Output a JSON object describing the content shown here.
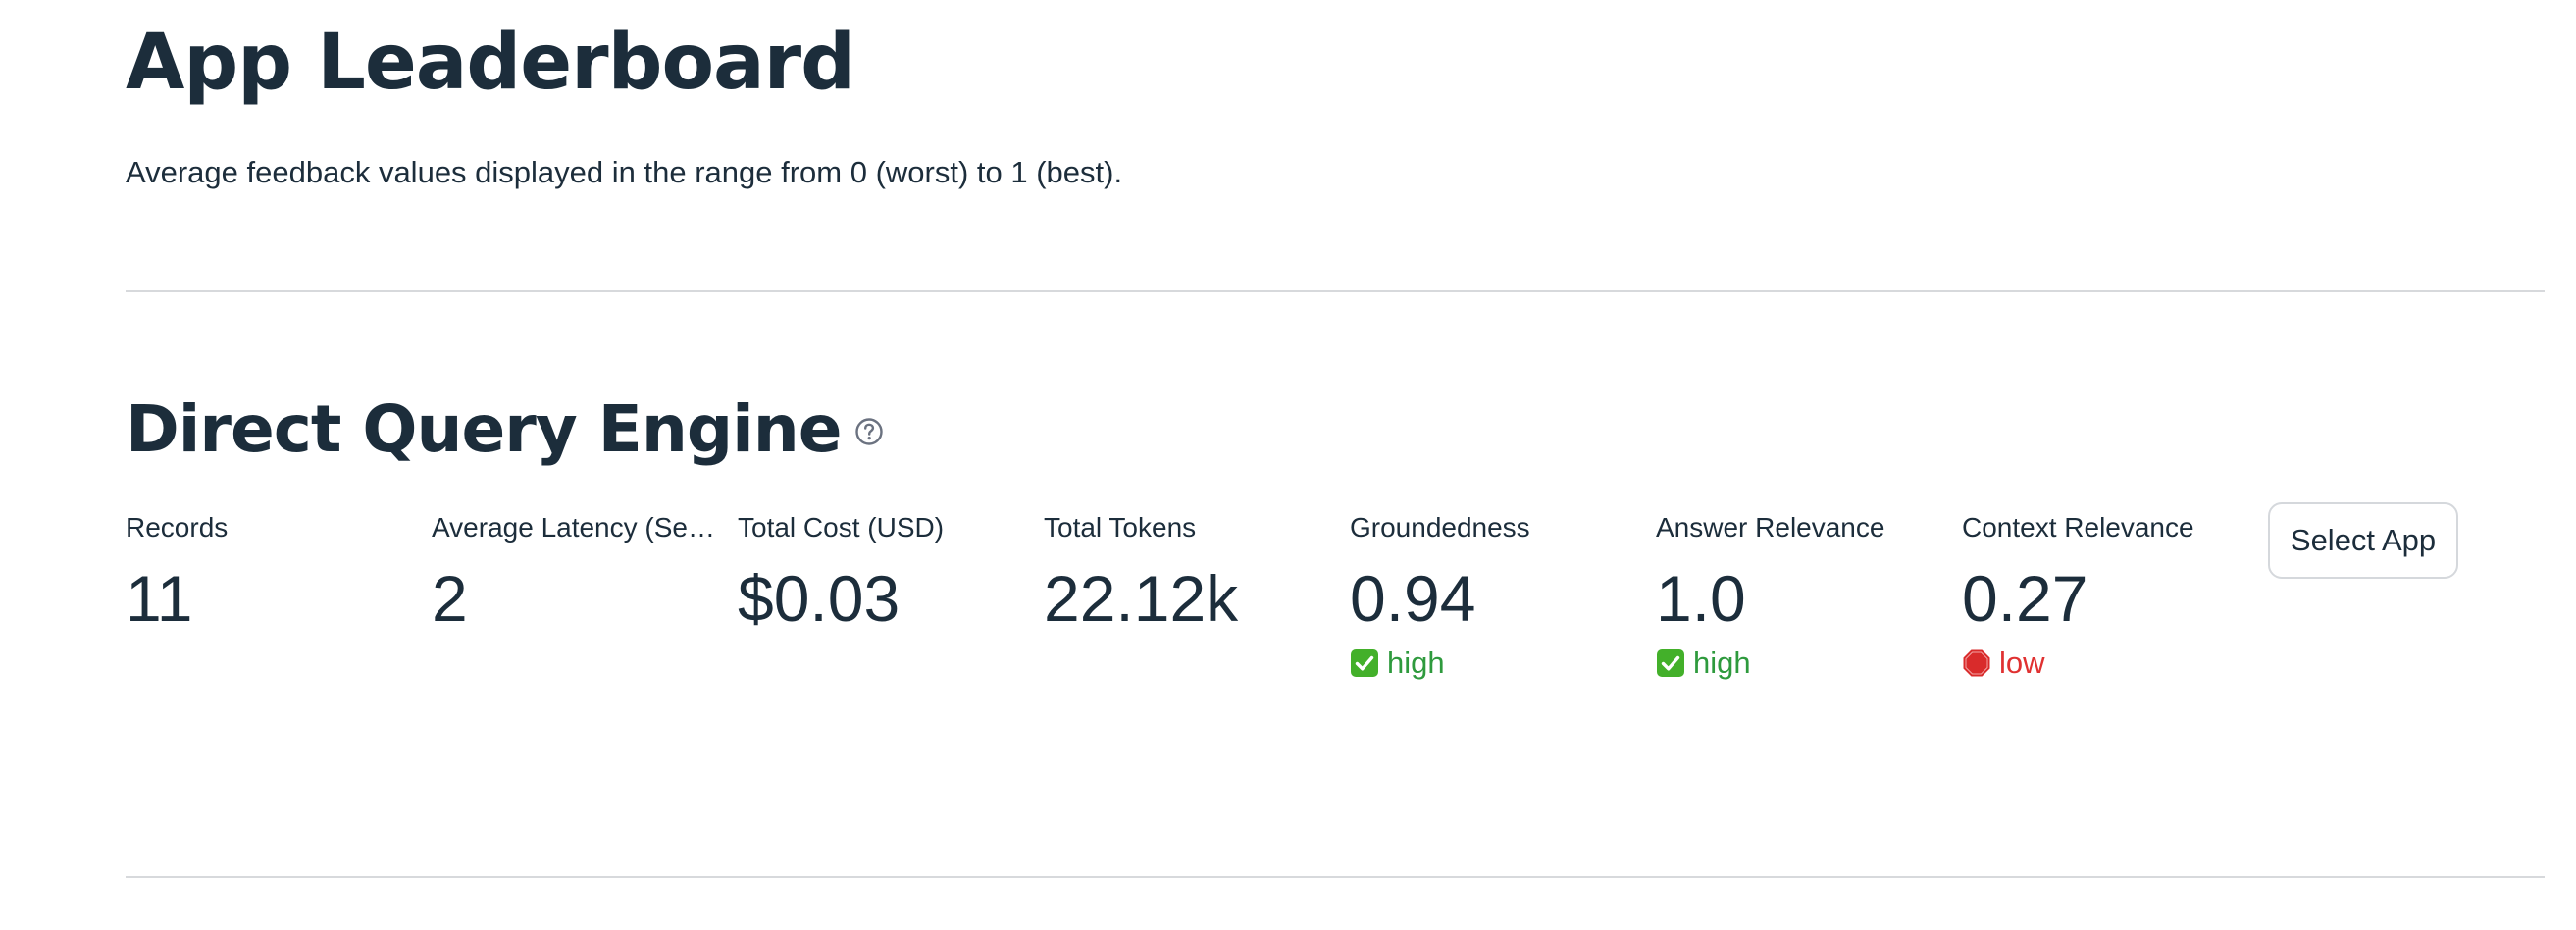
{
  "header": {
    "title": "App Leaderboard",
    "subtitle": "Average feedback values displayed in the range from 0 (worst) to 1 (best)."
  },
  "app": {
    "name": "Direct Query Engine",
    "help_icon": "question-circle-icon",
    "select_button_label": "Select App",
    "metrics": [
      {
        "label": "Records",
        "value": "11"
      },
      {
        "label": "Average Latency (Sec…",
        "value": "2"
      },
      {
        "label": "Total Cost (USD)",
        "value": "$0.03"
      },
      {
        "label": "Total Tokens",
        "value": "22.12k"
      },
      {
        "label": "Groundedness",
        "value": "0.94",
        "delta": "high",
        "delta_icon": "check-mark-icon"
      },
      {
        "label": "Answer Relevance",
        "value": "1.0",
        "delta": "high",
        "delta_icon": "check-mark-icon"
      },
      {
        "label": "Context Relevance",
        "value": "0.27",
        "delta": "low",
        "delta_icon": "stop-sign-icon"
      }
    ]
  },
  "colors": {
    "text": "#1c2d3b",
    "good": "#2e9a3d",
    "bad": "#e03131",
    "divider": "#d7d9dc"
  }
}
